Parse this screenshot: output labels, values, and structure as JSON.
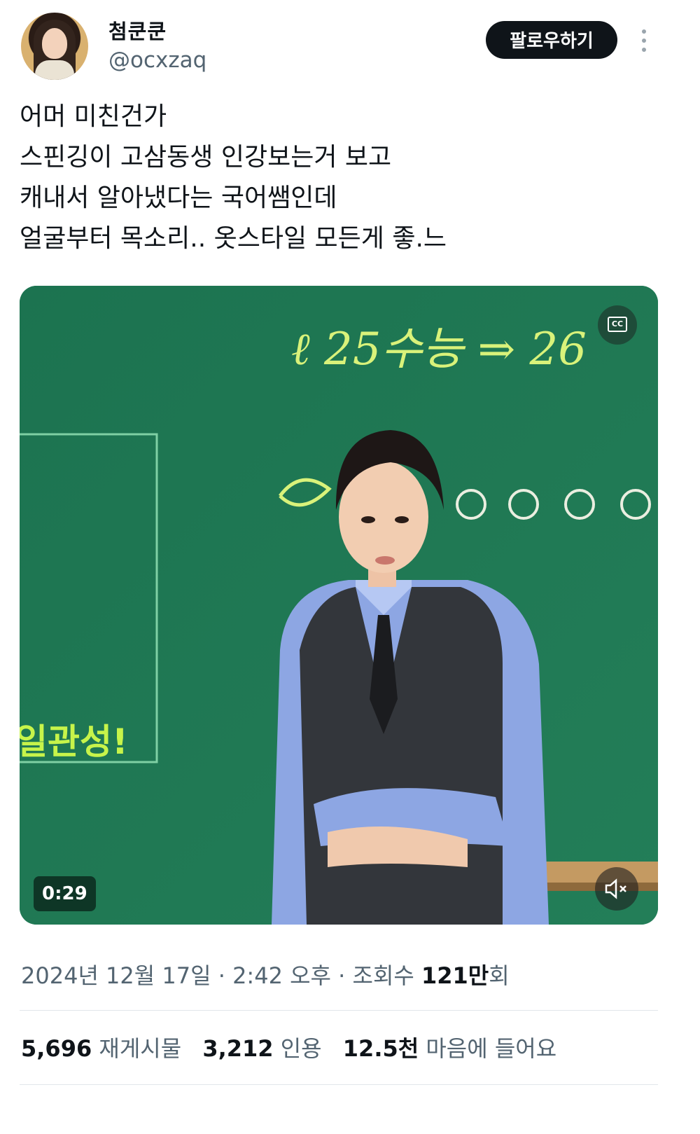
{
  "user": {
    "display_name": "첨쿤쿤",
    "handle": "@ocxzaq",
    "follow_label": "팔로우하기"
  },
  "tweet": {
    "lines": [
      "어머 미친건가",
      "스핀깅이 고삼동생 인강보는거 보고",
      "캐내서 알아냈다는 국어쌤인데",
      "얼굴부터 목소리.. 옷스타일 모든게 좋.느"
    ]
  },
  "media": {
    "duration": "0:29",
    "cc_label": "CC",
    "board_text_top": "ℓ 25수능 ⇒ 26",
    "board_text_side": "일관성!"
  },
  "meta": {
    "date": "2024년 12월 17일",
    "time": "2:42 오후",
    "views_prefix": "조회수",
    "views_num": "121만",
    "views_suffix": "회",
    "separator": "·"
  },
  "stats": {
    "reposts_num": "5,696",
    "reposts_label": "재게시물",
    "quotes_num": "3,212",
    "quotes_label": "인용",
    "likes_num": "12.5천",
    "likes_label": "마음에 들어요"
  },
  "colors": {
    "board": "#1f7a55",
    "chalk": "#d9f27a",
    "shirt": "#8da6e3",
    "vest": "#33363b"
  }
}
